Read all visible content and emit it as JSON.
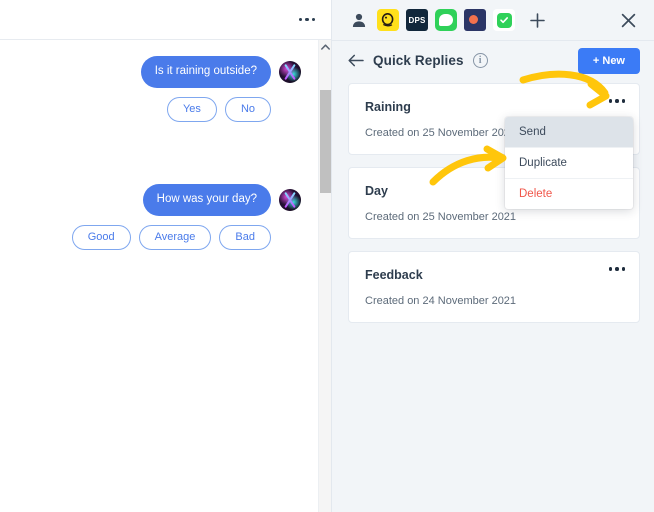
{
  "chat": {
    "menu_icon": "more-horizontal-icon",
    "messages": [
      {
        "text": "Is it raining outside?",
        "avatar": "user-avatar",
        "replies": [
          "Yes",
          "No"
        ]
      },
      {
        "text": "How was your day?",
        "avatar": "user-avatar",
        "replies": [
          "Good",
          "Average",
          "Bad"
        ]
      }
    ],
    "scrollbar": {
      "up_arrow_icon": "chevron-up-icon"
    }
  },
  "apps_bar": {
    "icons": [
      {
        "name": "person-icon",
        "label": ""
      },
      {
        "name": "mailchimp-icon",
        "label": ""
      },
      {
        "name": "dps-icon",
        "label": "DPS"
      },
      {
        "name": "messages-icon",
        "label": "",
        "active": true
      },
      {
        "name": "dribbble-icon",
        "label": ""
      },
      {
        "name": "checkbox-icon",
        "label": ""
      }
    ],
    "add_icon": "plus-icon",
    "close_icon": "close-icon"
  },
  "panel": {
    "back_icon": "arrow-left-icon",
    "title": "Quick Replies",
    "info_icon": "info-icon",
    "info_glyph": "i",
    "new_button": "+ New"
  },
  "quick_replies": [
    {
      "title": "Raining",
      "created": "Created on 25 November 2021",
      "menu_icon": "more-horizontal-icon"
    },
    {
      "title": "Day",
      "created": "Created on 25 November 2021",
      "menu_icon": "more-horizontal-icon"
    },
    {
      "title": "Feedback",
      "created": "Created on 24 November 2021",
      "menu_icon": "more-horizontal-icon"
    }
  ],
  "dropdown": {
    "items": [
      {
        "label": "Send",
        "state": "hover"
      },
      {
        "label": "Duplicate",
        "state": "normal"
      },
      {
        "label": "Delete",
        "state": "danger"
      }
    ]
  },
  "annotations": {
    "arrow_color": "#FFC60B",
    "arrows": [
      {
        "name": "arrow-to-menu-button",
        "target": "raining-menu-button"
      },
      {
        "name": "arrow-to-duplicate",
        "target": "duplicate-menu-item"
      }
    ]
  },
  "colors": {
    "accent_blue": "#3b7bf6",
    "bubble_blue": "#4a7bea",
    "danger_red": "#f0564a",
    "panel_bg": "#f2f5f8",
    "arrow_yellow": "#FFC60B"
  }
}
